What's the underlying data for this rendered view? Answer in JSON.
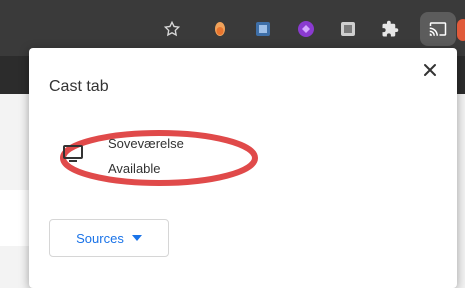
{
  "toolbar": {
    "icons": [
      "star-icon",
      "extension-orange-icon",
      "extension-blue-icon",
      "extension-purple-icon",
      "extension-grey-icon",
      "puzzle-icon",
      "cast-icon"
    ]
  },
  "cast_popup": {
    "title": "Cast tab",
    "close_icon": "close-icon",
    "sink": {
      "icon": "monitor-icon",
      "name": "Soveværelse",
      "status": "Available"
    },
    "sources_button": {
      "label": "Sources",
      "icon": "caret-down-icon"
    }
  },
  "colors": {
    "toolbar_bg": "#3a3a3a",
    "accent": "#1a73e8",
    "highlight": "#e04a4a"
  }
}
